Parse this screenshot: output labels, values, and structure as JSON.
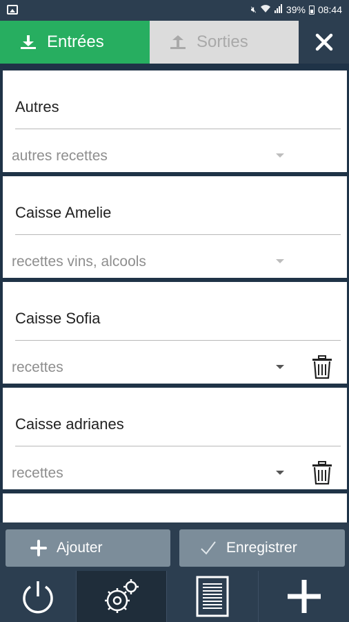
{
  "status_bar": {
    "battery_pct": "39%",
    "time": "08:44",
    "icons": [
      "gallery-icon",
      "mute-icon",
      "wifi-icon",
      "signal-icon",
      "battery-icon"
    ]
  },
  "tabs": {
    "entrees_label": "Entrées",
    "sorties_label": "Sorties",
    "active": "Entrées"
  },
  "cards": [
    {
      "name": "Autres",
      "category": "autres recettes",
      "deletable": false
    },
    {
      "name": "Caisse Amelie",
      "category": "recettes vins, alcools",
      "deletable": false
    },
    {
      "name": "Caisse Sofia",
      "category": "recettes",
      "deletable": true
    },
    {
      "name": "Caisse adrianes",
      "category": "recettes",
      "deletable": true
    }
  ],
  "actions": {
    "add_label": "Ajouter",
    "save_label": "Enregistrer"
  },
  "bottom_nav": {
    "items": [
      "power-icon",
      "settings-icon",
      "document-icon",
      "add-icon"
    ],
    "active": "settings-icon"
  },
  "colors": {
    "accent_green": "#27ae60",
    "header_dark": "#2c3e50",
    "button_grey": "#7c8d9a",
    "inactive_tab": "#dcdcdc"
  }
}
